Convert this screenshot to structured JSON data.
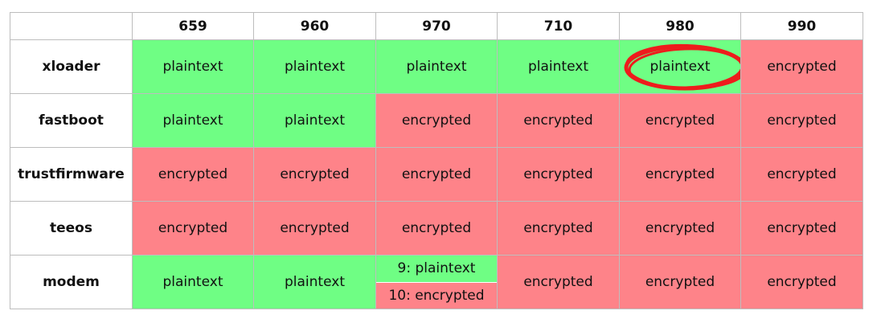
{
  "columns": [
    "659",
    "960",
    "970",
    "710",
    "980",
    "990"
  ],
  "rows": [
    {
      "label": "xloader",
      "cells": [
        {
          "text": "plaintext",
          "status": "plain"
        },
        {
          "text": "plaintext",
          "status": "plain"
        },
        {
          "text": "plaintext",
          "status": "plain"
        },
        {
          "text": "plaintext",
          "status": "plain"
        },
        {
          "text": "plaintext",
          "status": "plain",
          "highlighted": true
        },
        {
          "text": "encrypted",
          "status": "enc"
        }
      ]
    },
    {
      "label": "fastboot",
      "cells": [
        {
          "text": "plaintext",
          "status": "plain"
        },
        {
          "text": "plaintext",
          "status": "plain"
        },
        {
          "text": "encrypted",
          "status": "enc"
        },
        {
          "text": "encrypted",
          "status": "enc"
        },
        {
          "text": "encrypted",
          "status": "enc"
        },
        {
          "text": "encrypted",
          "status": "enc"
        }
      ]
    },
    {
      "label": "trustfirmware",
      "cells": [
        {
          "text": "encrypted",
          "status": "enc"
        },
        {
          "text": "encrypted",
          "status": "enc"
        },
        {
          "text": "encrypted",
          "status": "enc"
        },
        {
          "text": "encrypted",
          "status": "enc"
        },
        {
          "text": "encrypted",
          "status": "enc"
        },
        {
          "text": "encrypted",
          "status": "enc"
        }
      ]
    },
    {
      "label": "teeos",
      "cells": [
        {
          "text": "encrypted",
          "status": "enc"
        },
        {
          "text": "encrypted",
          "status": "enc"
        },
        {
          "text": "encrypted",
          "status": "enc"
        },
        {
          "text": "encrypted",
          "status": "enc"
        },
        {
          "text": "encrypted",
          "status": "enc"
        },
        {
          "text": "encrypted",
          "status": "enc"
        }
      ]
    },
    {
      "label": "modem",
      "cells": [
        {
          "text": "plaintext",
          "status": "plain"
        },
        {
          "text": "plaintext",
          "status": "plain"
        },
        {
          "split": [
            {
              "text": "9: plaintext",
              "status": "plain"
            },
            {
              "text": "10: encrypted",
              "status": "enc"
            }
          ]
        },
        {
          "text": "encrypted",
          "status": "enc"
        },
        {
          "text": "encrypted",
          "status": "enc"
        },
        {
          "text": "encrypted",
          "status": "enc"
        }
      ]
    }
  ],
  "colors": {
    "plain": "#6ffe84",
    "encrypted": "#fe8389",
    "highlight_ring": "#ee1c1c"
  }
}
